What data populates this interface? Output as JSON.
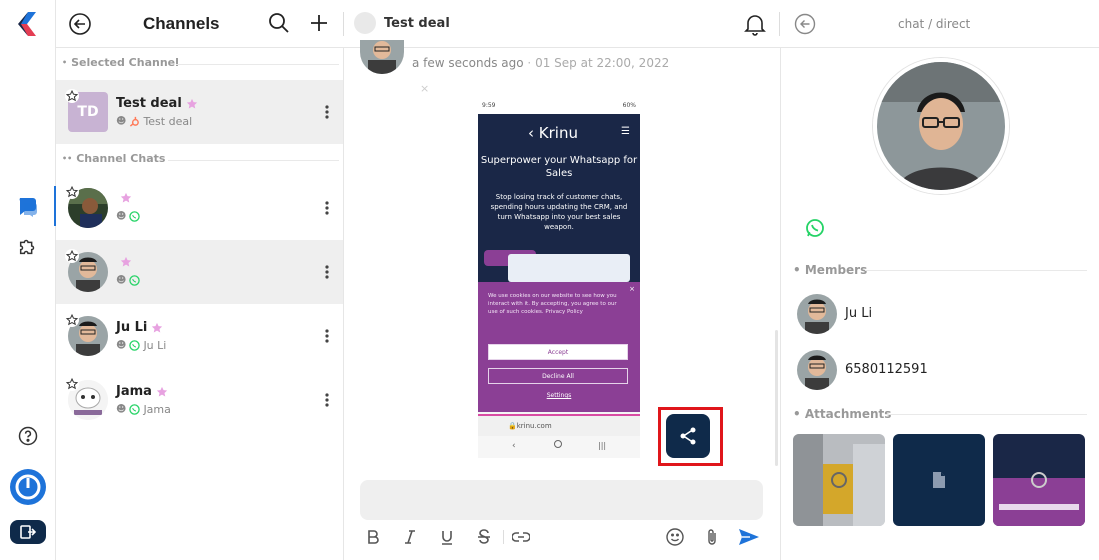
{
  "header": {
    "channels_title": "Channels",
    "chat_title": "Test deal",
    "breadcrumb": "chat / direct"
  },
  "channels": {
    "selected_section": "Selected Channel",
    "chats_section": "Channel Chats",
    "selected": {
      "initials": "TD",
      "name": "Test deal",
      "sub": "Test deal"
    },
    "chats": [
      {
        "name": "",
        "sub": ""
      },
      {
        "name": "",
        "sub": ""
      },
      {
        "name": "Ju Li",
        "sub": "Ju Li"
      },
      {
        "name": "Jama",
        "sub": "Jama"
      }
    ]
  },
  "message": {
    "time": "a few seconds ago",
    "separator": "·",
    "date": "01 Sep at 22:00, 2022",
    "screenshot": {
      "status_left": "9:59",
      "status_right": "60%",
      "brand": "Krinu",
      "headline": "Superpower your Whatsapp for Sales",
      "body": "Stop losing track of customer chats, spending hours updating the CRM, and turn Whatsapp into your best sales weapon.",
      "cookie_text": "We use cookies on our website to see how you interact with it. By accepting, you agree to our use of such cookies. Privacy Policy",
      "accept": "Accept",
      "decline": "Decline All",
      "settings": "Settings",
      "url": "krinu.com"
    }
  },
  "composer": {
    "placeholder": ""
  },
  "info": {
    "members_title": "Members",
    "members": [
      {
        "name": "Ju Li"
      },
      {
        "name": "6580112591"
      }
    ],
    "attachments_title": "Attachments"
  },
  "colors": {
    "accent": "#1e73d9",
    "navy": "#0f2a4a",
    "whatsapp": "#25d366",
    "hubspot": "#ff7a59",
    "highlight": "#e0161b",
    "star_pink": "#e7a2e0"
  },
  "icons": [
    "back-icon",
    "search-icon",
    "plus-icon",
    "bell-icon",
    "chat-icon",
    "puzzle-icon",
    "help-icon",
    "power-icon",
    "logout-icon",
    "share-icon",
    "star-icon",
    "kebab-icon",
    "whatsapp-icon",
    "hubspot-icon",
    "bold-icon",
    "italic-icon",
    "underline-icon",
    "strikethrough-icon",
    "link-icon",
    "emoji-icon",
    "attach-icon",
    "send-icon"
  ]
}
